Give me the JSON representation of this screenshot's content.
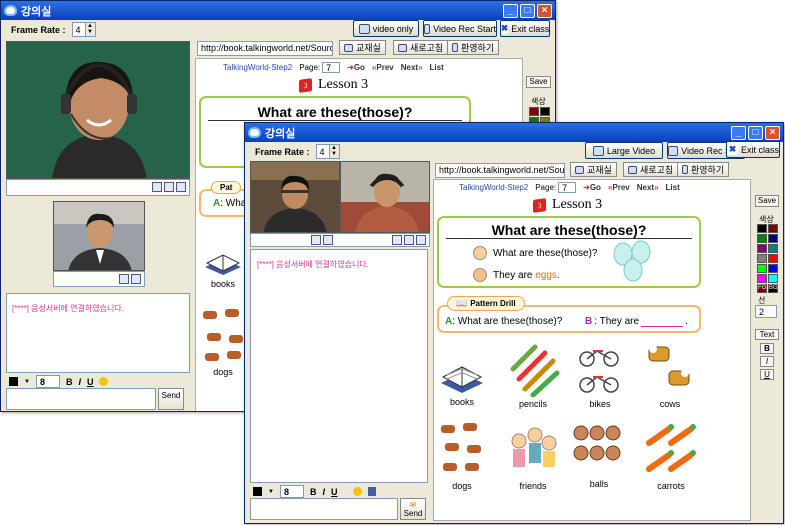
{
  "window1": {
    "title": "강의실",
    "frame_rate_label": "Frame Rate :",
    "frame_rate_value": "4",
    "video_only": "video only",
    "video_rec_start": "Video Rec Start",
    "exit_class": "Exit class",
    "url": "http://book.talkingworld.net/Source/View",
    "btn_classroom": "교재실",
    "btn_refresh": "새로고침",
    "btn_welcome": "환영하기",
    "book_title": "TalkingWorld-Step2",
    "page_label": "Page:",
    "page_value": "7",
    "go": "Go",
    "prev": "Prev",
    "next": "Next",
    "list": "List",
    "lesson": "Lesson  3",
    "question_title": "What are these(those)?",
    "pattern_label": "Pat",
    "pattern_a": "A",
    "pattern_text": ": Wha",
    "chat_msg": "[****] 음성서버에 연결하였습니다.",
    "font_size": "8",
    "send": "Send",
    "save": "Save",
    "color_label": "색상",
    "words": [
      "books",
      "dogs"
    ]
  },
  "window2": {
    "title": "강의실",
    "frame_rate_label": "Frame Rate :",
    "frame_rate_value": "4",
    "large_video": "Large Video",
    "video_rec_start": "Video Rec Start",
    "exit_class": "Exit class",
    "url": "http://book.talkingworld.net/Source/View",
    "btn_classroom": "교재실",
    "btn_refresh": "새로고침",
    "btn_welcome": "환영하기",
    "book_title": "TalkingWorld-Step2",
    "page_label": "Page:",
    "page_value": "7",
    "go": "Go",
    "prev": "Prev",
    "next": "Next",
    "list": "List",
    "lesson": "Lesson  3",
    "question_title": "What are these(those)?",
    "q_line": "What are these(those)?",
    "a_line_prefix": "They are ",
    "a_line_answer": "eggs",
    "a_line_suffix": ".",
    "pattern_drill": "Pattern Drill",
    "drill_a_letter": "A",
    "drill_a_text": ": What are these(those)?",
    "drill_b_letter": "B",
    "drill_b_text": ": They are",
    "drill_end": ".",
    "chat_msg": "[****] 음성서버에 연결하였습니다.",
    "font_size": "8",
    "send": "Send",
    "save": "Save",
    "color_label": "색상",
    "line_label": "선",
    "line_value": "2",
    "text_btn": "Text",
    "bold": "B",
    "italic": "I",
    "underline": "U",
    "fmt_bold": "B",
    "fmt_italic": "I",
    "fmt_underline": "U",
    "fg": "FG",
    "bg": "BG",
    "words": [
      "books",
      "pencils",
      "bikes",
      "cows",
      "dogs",
      "friends",
      "balls",
      "carrots"
    ]
  },
  "colors": {
    "title_blue": "#0a3fbf",
    "green_border": "#9ccb48",
    "orange_border": "#f5b86a",
    "chat_pink": "#e0308c"
  }
}
